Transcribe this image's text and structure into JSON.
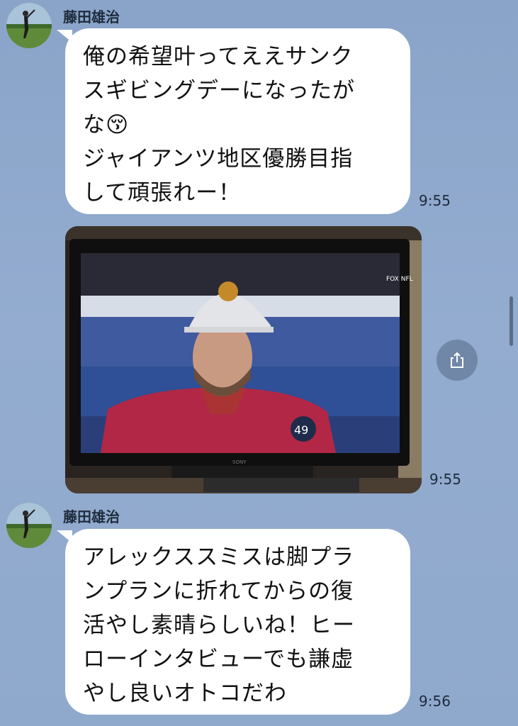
{
  "messages": [
    {
      "sender": "藤田雄治",
      "lines": [
        "俺の希望叶ってええサンク",
        "スギビングデーになったが",
        "な😚",
        "ジャイアンツ地区優勝目指",
        "して頑張れー！"
      ],
      "time": "9:55"
    },
    {
      "type": "image",
      "image_text": {
        "network_logo": "FOX NFL",
        "jersey_number": "49",
        "tv_brand": "SONY"
      },
      "time": "9:55"
    },
    {
      "sender": "藤田雄治",
      "lines": [
        "アレックススミスは脚プラ",
        "ンプランに折れてからの復",
        "活やし素晴らしいね！ヒー",
        "ローインタビューでも謙虚",
        "やし良いオトコだわ"
      ],
      "time": "9:56"
    }
  ],
  "icons": {
    "share": "share-icon",
    "avatar": "golfer-avatar"
  },
  "colors": {
    "background": "#8fa9cd",
    "bubble": "#ffffff",
    "text": "#1f2b3c"
  }
}
